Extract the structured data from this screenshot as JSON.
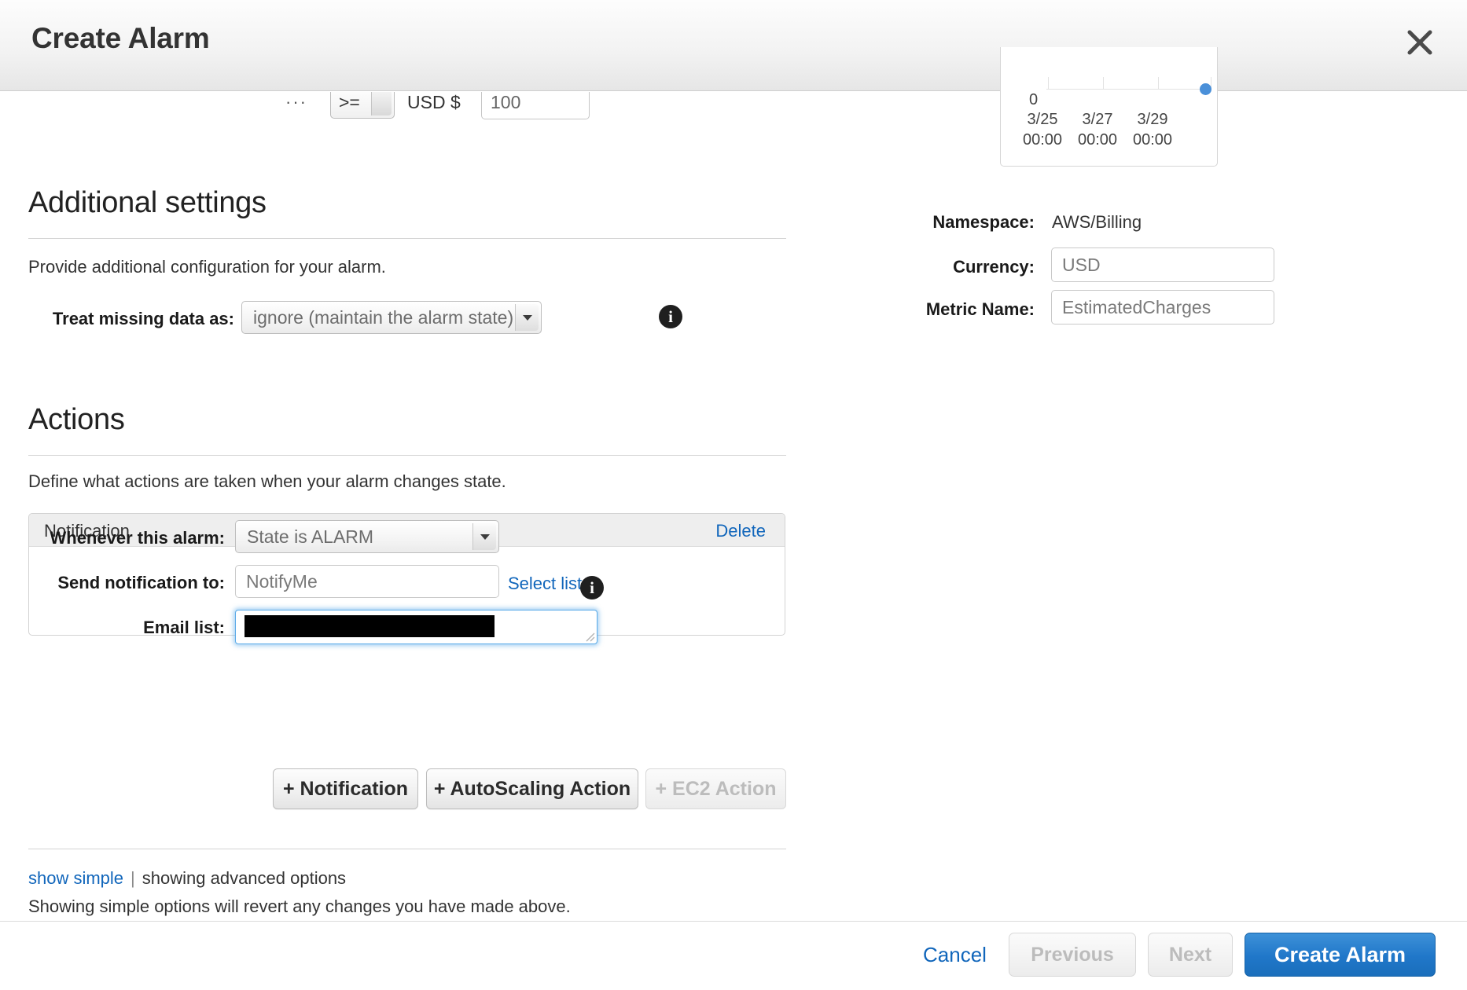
{
  "modal": {
    "title": "Create Alarm",
    "close_icon": "close-icon"
  },
  "threshold_row": {
    "ellipsis": "···",
    "operator": ">=",
    "currency_label": "USD $",
    "value": "100"
  },
  "additional_settings": {
    "heading": "Additional settings",
    "description": "Provide additional configuration for your alarm.",
    "treat_missing_data_label": "Treat missing data as:",
    "treat_missing_data_value": "ignore (maintain the alarm state)",
    "info_icon": "info-icon"
  },
  "actions": {
    "heading": "Actions",
    "description": "Define what actions are taken when your alarm changes state.",
    "notification_panel": {
      "title": "Notification",
      "delete_label": "Delete",
      "whenever_label": "Whenever this alarm:",
      "whenever_value": "State is ALARM",
      "send_to_label": "Send notification to:",
      "send_to_value": "NotifyMe",
      "select_list_link": "Select list",
      "email_list_label": "Email list:",
      "email_list_value": ""
    },
    "buttons": {
      "add_notification": "+ Notification",
      "add_autoscaling": "+ AutoScaling Action",
      "add_ec2": "+ EC2 Action"
    }
  },
  "footer_options": {
    "show_simple_link": "show simple",
    "separator": "|",
    "current_mode": "showing advanced options",
    "revert_note": "Showing simple options will revert any changes you have made above."
  },
  "preview": {
    "namespace_label": "Namespace:",
    "namespace_value": "AWS/Billing",
    "currency_label": "Currency:",
    "currency_value": "USD",
    "metric_name_label": "Metric Name:",
    "metric_name_value": "EstimatedCharges"
  },
  "chart_data": {
    "type": "line",
    "title": "",
    "xlabel": "",
    "ylabel": "",
    "grid": true,
    "legend": "none",
    "ytick_labels": [
      "0"
    ],
    "ylim": [
      0,
      1
    ],
    "x": [
      "3/25 00:00",
      "3/27 00:00",
      "3/29 00:00"
    ],
    "xtick_labels": [
      "3/25\n00:00",
      "3/27\n00:00",
      "3/29\n00:00"
    ],
    "xticks_line1": [
      "3/25",
      "3/27",
      "3/29"
    ],
    "xticks_line2": [
      "00:00",
      "00:00",
      "00:00"
    ],
    "series": [
      {
        "name": "EstimatedCharges",
        "color": "#4a90d9",
        "values": [
          0,
          0,
          0
        ],
        "points": [
          {
            "x": "3/29 00:00",
            "y": 0
          }
        ]
      }
    ]
  },
  "bottom_bar": {
    "cancel": "Cancel",
    "previous": "Previous",
    "next": "Next",
    "create": "Create Alarm"
  }
}
